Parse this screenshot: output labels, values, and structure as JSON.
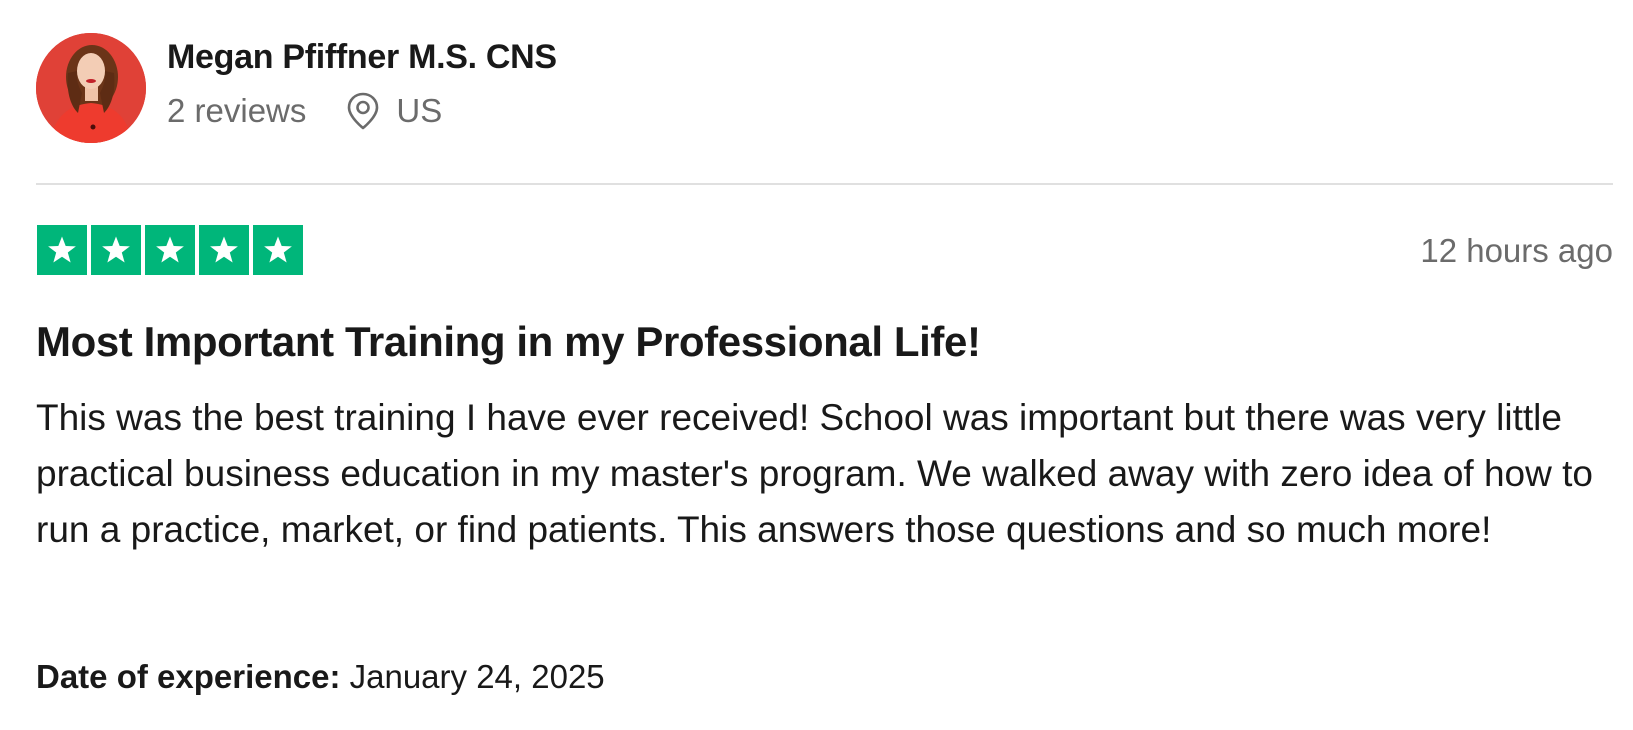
{
  "consumer": {
    "name": "Megan Pfiffner M.S. CNS",
    "reviews_count": "2 reviews",
    "location": "US",
    "avatar_icon": "profile-photo"
  },
  "review": {
    "rating": 5,
    "rating_max": 5,
    "star_color": "#00b67a",
    "date_posted": "12 hours ago",
    "title": "Most Important Training in my Professional Life!",
    "text": "This was the best training I have ever received! School was important but there was very little practical business education in my master's program. We walked away with zero idea of how to run a practice, market, or find patients. This answers those questions and so much more!",
    "experience_label": "Date of experience:",
    "experience_date": "January 24, 2025"
  }
}
